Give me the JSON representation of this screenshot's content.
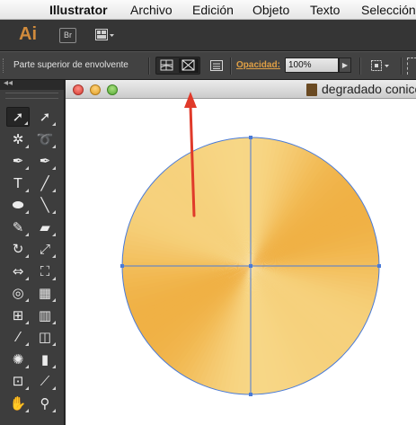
{
  "menubar": {
    "apple_icon": "apple-icon",
    "items": [
      "Illustrator",
      "Archivo",
      "Edición",
      "Objeto",
      "Texto",
      "Selección"
    ]
  },
  "app_bar": {
    "logo": "Ai",
    "bridge_label": "Br",
    "layout_icon": "workspace-layout-icon"
  },
  "control_bar": {
    "envelope_label": "Parte superior de envolvente",
    "envelope_buttons": [
      "edit-envelope-icon",
      "edit-contents-icon"
    ],
    "envelope_options_icon": "envelope-options-icon",
    "opacity_label": "Opacidad:",
    "opacity_value": "100%",
    "transform_icon": "transform-icon"
  },
  "tools_panel": {
    "collapse_icon": "double-chevron-left-icon",
    "tools": [
      "selection-tool",
      "direct-selection-tool",
      "magic-wand-tool",
      "lasso-tool",
      "pen-tool",
      "curvature-pen-tool",
      "type-tool",
      "line-segment-tool",
      "ellipse-tool",
      "paintbrush-tool",
      "pencil-tool",
      "eraser-tool",
      "rotate-tool",
      "scale-tool",
      "width-tool",
      "free-transform-tool",
      "shape-builder-tool",
      "perspective-grid-tool",
      "mesh-tool",
      "gradient-tool",
      "eyedropper-tool",
      "blend-tool",
      "symbol-sprayer-tool",
      "column-graph-tool",
      "artboard-tool",
      "slice-tool",
      "hand-tool",
      "zoom-tool"
    ]
  },
  "document": {
    "title": "degradado conico",
    "file_icon": "ai-file-icon"
  },
  "artwork": {
    "gradient_colors": [
      "#f6d27e",
      "#f0b145",
      "#fbe7a3"
    ],
    "path_color": "#4a7bd8",
    "arrow_color": "#e03a2a"
  }
}
